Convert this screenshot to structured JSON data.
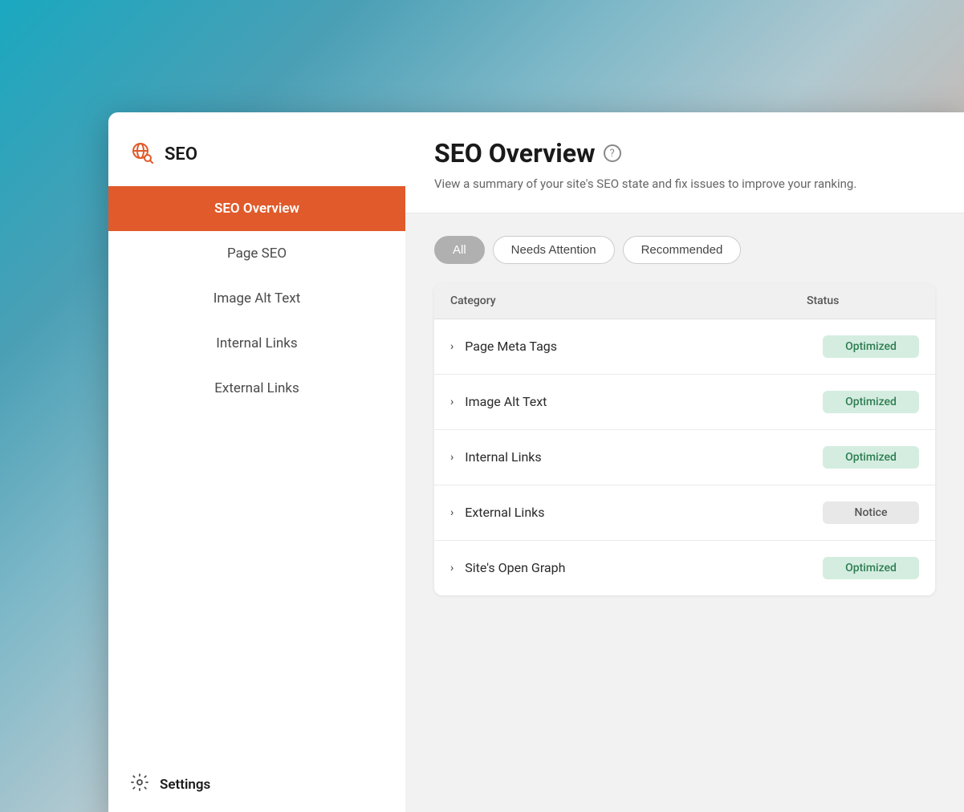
{
  "sidebar": {
    "header": {
      "title": "SEO",
      "icon_name": "globe-search-icon"
    },
    "nav_items": [
      {
        "id": "seo-overview",
        "label": "SEO Overview",
        "active": true
      },
      {
        "id": "page-seo",
        "label": "Page SEO",
        "active": false
      },
      {
        "id": "image-alt-text",
        "label": "Image Alt Text",
        "active": false
      },
      {
        "id": "internal-links",
        "label": "Internal Links",
        "active": false
      },
      {
        "id": "external-links",
        "label": "External Links",
        "active": false
      }
    ],
    "settings": {
      "label": "Settings",
      "icon_name": "settings-icon"
    }
  },
  "main": {
    "title": "SEO Overview",
    "help_icon": "?",
    "subtitle": "View a summary of your site's SEO state and fix issues to improve your ranking.",
    "filters": [
      {
        "id": "all",
        "label": "All",
        "active": true
      },
      {
        "id": "needs-attention",
        "label": "Needs Attention",
        "active": false
      },
      {
        "id": "recommended",
        "label": "Recommended",
        "active": false
      }
    ],
    "table": {
      "headers": {
        "category": "Category",
        "status": "Status"
      },
      "rows": [
        {
          "id": "page-meta-tags",
          "label": "Page Meta Tags",
          "status": "Optimized",
          "status_type": "optimized"
        },
        {
          "id": "image-alt-text",
          "label": "Image Alt Text",
          "status": "Optimized",
          "status_type": "optimized"
        },
        {
          "id": "internal-links",
          "label": "Internal Links",
          "status": "Optimized",
          "status_type": "optimized"
        },
        {
          "id": "external-links",
          "label": "External Links",
          "status": "Notice",
          "status_type": "notice"
        },
        {
          "id": "sites-open-graph",
          "label": "Site's Open Graph",
          "status": "Optimized",
          "status_type": "optimized"
        }
      ]
    }
  },
  "colors": {
    "active_nav": "#e05a2b",
    "optimized_bg": "#d4ede0",
    "optimized_text": "#2e7d52",
    "notice_bg": "#e8e8e8",
    "notice_text": "#555555"
  }
}
